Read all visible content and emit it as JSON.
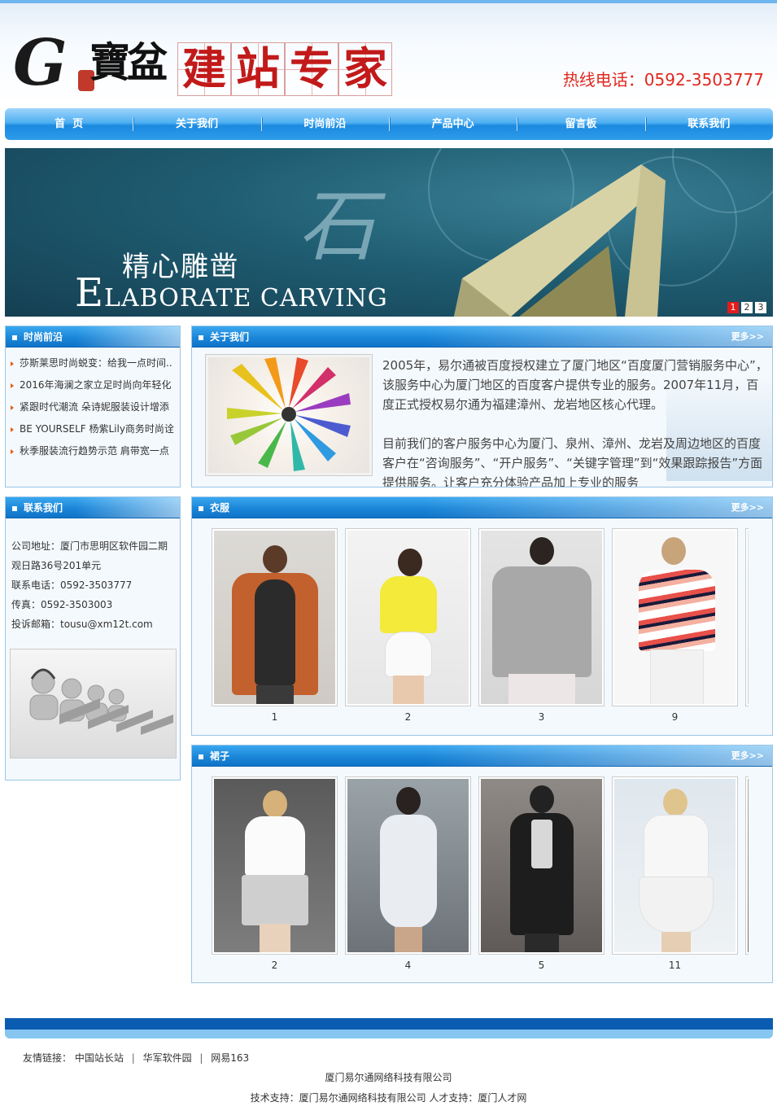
{
  "header": {
    "logo_letter": "G",
    "logo_calligraphy": "寶盆",
    "logo_chars": [
      "建",
      "站",
      "专",
      "家"
    ],
    "hotline": "热线电话：0592-3503777"
  },
  "nav": {
    "items": [
      "首  页",
      "关于我们",
      "时尚前沿",
      "产品中心",
      "留言板",
      "联系我们"
    ]
  },
  "banner": {
    "cn_text": "精心雕凿",
    "en_initial": "E",
    "en_text": "LABORATE CARVING",
    "glyph": "石",
    "slides": [
      "1",
      "2",
      "3"
    ],
    "active_slide": "1"
  },
  "news": {
    "title": "时尚前沿",
    "items": [
      "莎斯莱思时尚蜕变：给我一点时间..",
      "2016年海澜之家立足时尚向年轻化",
      "紧跟时代潮流 朵诗妮服装设计增添",
      "BE YOURSELF 杨紫Lily商务时尚诠",
      "秋季服装流行趋势示范 肩带宽一点"
    ]
  },
  "contact": {
    "title": "联系我们",
    "lines": [
      "公司地址：厦门市思明区软件园二期",
      "观日路36号201单元",
      "联系电话：0592-3503777",
      "传真：0592-3503003",
      "投诉邮箱：tousu@xm12t.com"
    ]
  },
  "about": {
    "title": "关于我们",
    "more": "更多>>",
    "paragraphs": [
      "2005年，易尔通被百度授权建立了厦门地区“百度厦门营销服务中心”，该服务中心为厦门地区的百度客户提供专业的服务。2007年11月，百度正式授权易尔通为福建漳州、龙岩地区核心代理。",
      "目前我们的客户服务中心为厦门、泉州、漳州、龙岩及周边地区的百度客户在“咨询服务”、“开户服务”、“关键字管理”到“效果跟踪报告”方面提供服务。让客户充分体验产品加上专业的服务"
    ]
  },
  "clothes": {
    "title": "衣服",
    "more": "更多>>",
    "items": [
      "1",
      "2",
      "3",
      "9"
    ]
  },
  "skirts": {
    "title": "裙子",
    "more": "更多>>",
    "items": [
      "2",
      "4",
      "5",
      "11"
    ]
  },
  "footer": {
    "links_label": "友情链接：",
    "links": [
      "中国站长站",
      "华军软件园",
      "网易163"
    ],
    "separator": "|",
    "company": "厦门易尔通网络科技有限公司",
    "support": "技术支持：厦门易尔通网络科技有限公司 人才支持：厦门人才网"
  },
  "colors": {
    "nav_blue": "#1a8ae0",
    "hotline_red": "#e0281e",
    "footer_blue": "#0a5cb0",
    "active_dot": "#e31b1b"
  }
}
